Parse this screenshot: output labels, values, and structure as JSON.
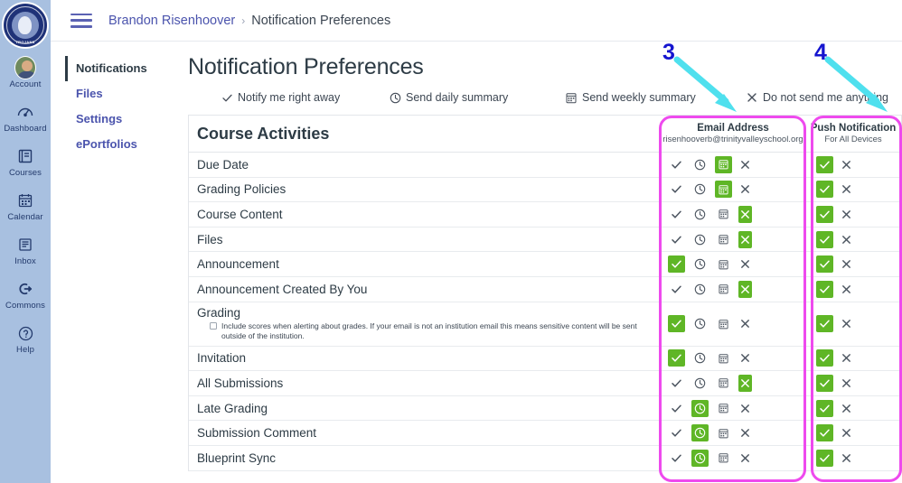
{
  "global_nav": {
    "logo": {
      "name": "trinity-valley-school-seal",
      "line1": "TRINITY VALLEY SCHOOL",
      "line2": "TROJANS"
    },
    "items": [
      {
        "label": "Account",
        "icon": "avatar-icon"
      },
      {
        "label": "Dashboard",
        "icon": "dashboard-icon"
      },
      {
        "label": "Courses",
        "icon": "courses-icon"
      },
      {
        "label": "Calendar",
        "icon": "calendar-icon"
      },
      {
        "label": "Inbox",
        "icon": "inbox-icon"
      },
      {
        "label": "Commons",
        "icon": "commons-icon"
      },
      {
        "label": "Help",
        "icon": "help-icon"
      }
    ]
  },
  "topbar": {
    "menu_icon": "hamburger-icon",
    "breadcrumb_user": "Brandon Risenhoover",
    "breadcrumb_separator": "›",
    "breadcrumb_current": "Notification Preferences"
  },
  "content_nav": {
    "items": [
      {
        "label": "Notifications",
        "active": true
      },
      {
        "label": "Files",
        "active": false
      },
      {
        "label": "Settings",
        "active": false
      },
      {
        "label": "ePortfolios",
        "active": false
      }
    ]
  },
  "main": {
    "page_title": "Notification Preferences",
    "legend": [
      {
        "label": "Notify me right away",
        "icon": "check-icon"
      },
      {
        "label": "Send daily summary",
        "icon": "clock-icon"
      },
      {
        "label": "Send weekly summary",
        "icon": "calendar-icon"
      },
      {
        "label": "Do not send me anything",
        "icon": "x-icon"
      }
    ],
    "table": {
      "section_title": "Course Activities",
      "columns": [
        {
          "title": "Email Address",
          "sub": "risenhooverb@trinityvalleyschool.org"
        },
        {
          "title": "Push Notification",
          "sub": "For All Devices"
        }
      ],
      "rows": [
        {
          "label": "Due Date",
          "sub": null,
          "email": [
            "check",
            "clock",
            "calendar",
            "x"
          ],
          "email_selected": "calendar",
          "push": [
            "check",
            "x"
          ],
          "push_selected": "check"
        },
        {
          "label": "Grading Policies",
          "sub": null,
          "email": [
            "check",
            "clock",
            "calendar",
            "x"
          ],
          "email_selected": "calendar",
          "push": [
            "check",
            "x"
          ],
          "push_selected": "check"
        },
        {
          "label": "Course Content",
          "sub": null,
          "email": [
            "check",
            "clock",
            "calendar",
            "x"
          ],
          "email_selected": "x",
          "push": [
            "check",
            "x"
          ],
          "push_selected": "check"
        },
        {
          "label": "Files",
          "sub": null,
          "email": [
            "check",
            "clock",
            "calendar",
            "x"
          ],
          "email_selected": "x",
          "push": [
            "check",
            "x"
          ],
          "push_selected": "check"
        },
        {
          "label": "Announcement",
          "sub": null,
          "email": [
            "check",
            "clock",
            "calendar",
            "x"
          ],
          "email_selected": "check",
          "push": [
            "check",
            "x"
          ],
          "push_selected": "check"
        },
        {
          "label": "Announcement Created By You",
          "sub": null,
          "email": [
            "check",
            "clock",
            "calendar",
            "x"
          ],
          "email_selected": "x",
          "push": [
            "check",
            "x"
          ],
          "push_selected": "check"
        },
        {
          "label": "Grading",
          "sub": "Include scores when alerting about grades. If your email is not an institution email this means sensitive content will be sent outside of the institution.",
          "email": [
            "check",
            "clock",
            "calendar",
            "x"
          ],
          "email_selected": "check",
          "push": [
            "check",
            "x"
          ],
          "push_selected": "check"
        },
        {
          "label": "Invitation",
          "sub": null,
          "email": [
            "check",
            "clock",
            "calendar",
            "x"
          ],
          "email_selected": "check",
          "push": [
            "check",
            "x"
          ],
          "push_selected": "check"
        },
        {
          "label": "All Submissions",
          "sub": null,
          "email": [
            "check",
            "clock",
            "calendar",
            "x"
          ],
          "email_selected": "x",
          "push": [
            "check",
            "x"
          ],
          "push_selected": "check"
        },
        {
          "label": "Late Grading",
          "sub": null,
          "email": [
            "check",
            "clock",
            "calendar",
            "x"
          ],
          "email_selected": "clock",
          "push": [
            "check",
            "x"
          ],
          "push_selected": "check"
        },
        {
          "label": "Submission Comment",
          "sub": null,
          "email": [
            "check",
            "clock",
            "calendar",
            "x"
          ],
          "email_selected": "clock",
          "push": [
            "check",
            "x"
          ],
          "push_selected": "check"
        },
        {
          "label": "Blueprint Sync",
          "sub": null,
          "email": [
            "check",
            "clock",
            "calendar",
            "x"
          ],
          "email_selected": "clock",
          "push": [
            "check",
            "x"
          ],
          "push_selected": "check"
        }
      ]
    }
  },
  "annotations": [
    {
      "number": "3",
      "target": "email-address-column"
    },
    {
      "number": "4",
      "target": "push-notification-column"
    }
  ],
  "colors": {
    "selected_green": "#5fb626",
    "highlight_pink": "#ee4aee",
    "annotation_blue": "#1515cf",
    "arrow_cyan": "#4fe0ee",
    "nav_blue": "#a8c0e0",
    "link_purple": "#4b54ad"
  }
}
